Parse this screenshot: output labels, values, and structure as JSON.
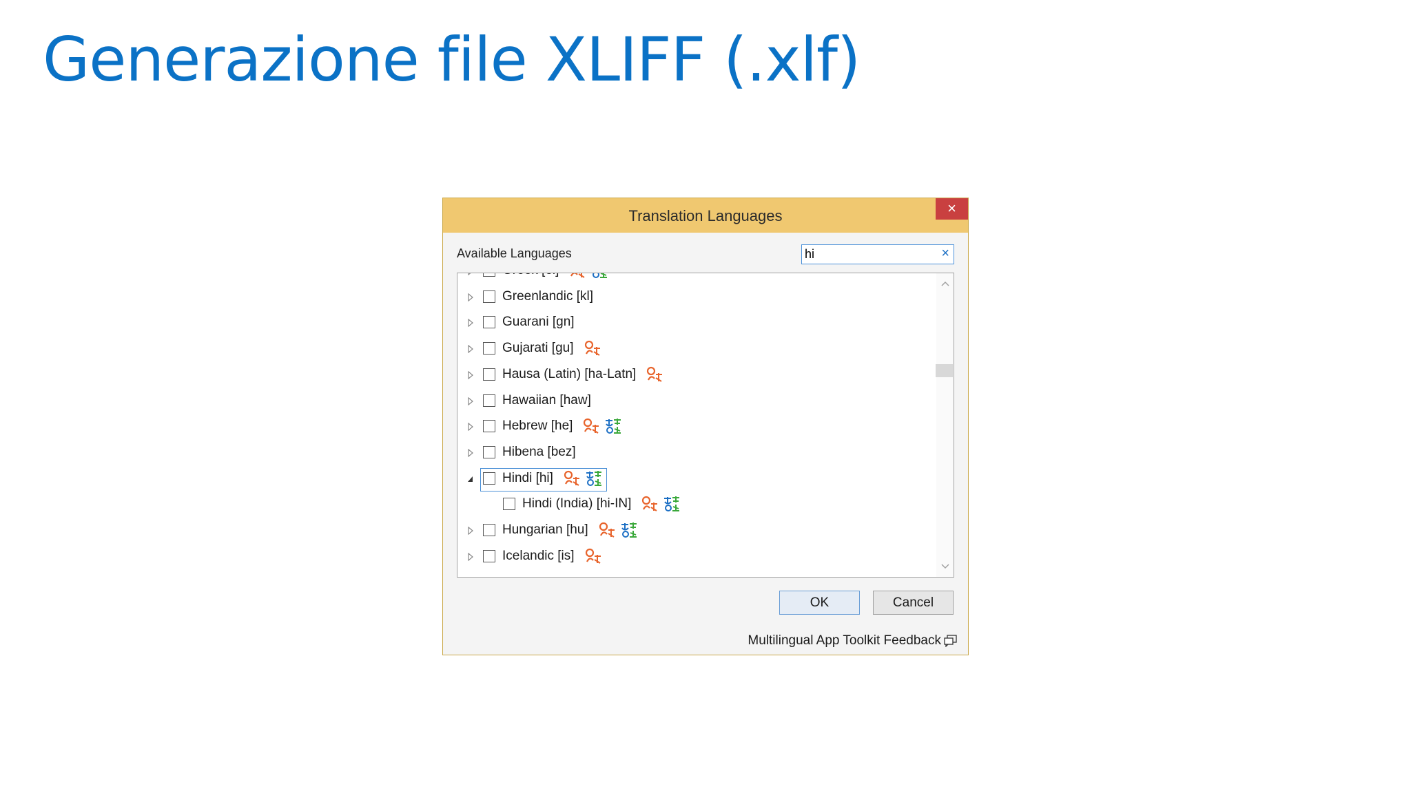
{
  "slide": {
    "title": "Generazione file XLIFF (.xlf)"
  },
  "dialog": {
    "title": "Translation Languages",
    "close_label": "×",
    "available_label": "Available Languages",
    "search_value": "hi",
    "search_clear": "×",
    "ok_label": "OK",
    "cancel_label": "Cancel",
    "feedback_label": "Multilingual App Toolkit Feedback",
    "items": [
      {
        "label": "Greek [el]",
        "expander": "collapsed",
        "icons": [
          "machine-translation-icon",
          "translation-memory-icon"
        ],
        "partially_visible": true
      },
      {
        "label": "Greenlandic [kl]",
        "expander": "collapsed",
        "icons": []
      },
      {
        "label": "Guarani [gn]",
        "expander": "collapsed",
        "icons": []
      },
      {
        "label": "Gujarati [gu]",
        "expander": "collapsed",
        "icons": [
          "machine-translation-icon"
        ]
      },
      {
        "label": "Hausa (Latin) [ha-Latn]",
        "expander": "collapsed",
        "icons": [
          "machine-translation-icon"
        ]
      },
      {
        "label": "Hawaiian [haw]",
        "expander": "collapsed",
        "icons": []
      },
      {
        "label": "Hebrew [he]",
        "expander": "collapsed",
        "icons": [
          "machine-translation-icon",
          "translation-memory-icon"
        ]
      },
      {
        "label": "Hibena [bez]",
        "expander": "collapsed",
        "icons": []
      },
      {
        "label": "Hindi [hi]",
        "expander": "expanded",
        "icons": [
          "machine-translation-icon",
          "translation-memory-icon"
        ],
        "focused": true
      },
      {
        "label": "Hindi (India) [hi-IN]",
        "expander": "none",
        "icons": [
          "machine-translation-icon",
          "translation-memory-icon"
        ],
        "child": true
      },
      {
        "label": "Hungarian [hu]",
        "expander": "collapsed",
        "icons": [
          "machine-translation-icon",
          "translation-memory-icon"
        ]
      },
      {
        "label": "Icelandic [is]",
        "expander": "collapsed",
        "icons": [
          "machine-translation-icon"
        ]
      }
    ]
  },
  "colors": {
    "title_blue": "#0b72c6",
    "titlebar": "#f0c870",
    "close_red": "#c94040",
    "mt_orange": "#e8642c",
    "tm_green": "#3aa83a",
    "tm_blue": "#1c6fc4"
  }
}
